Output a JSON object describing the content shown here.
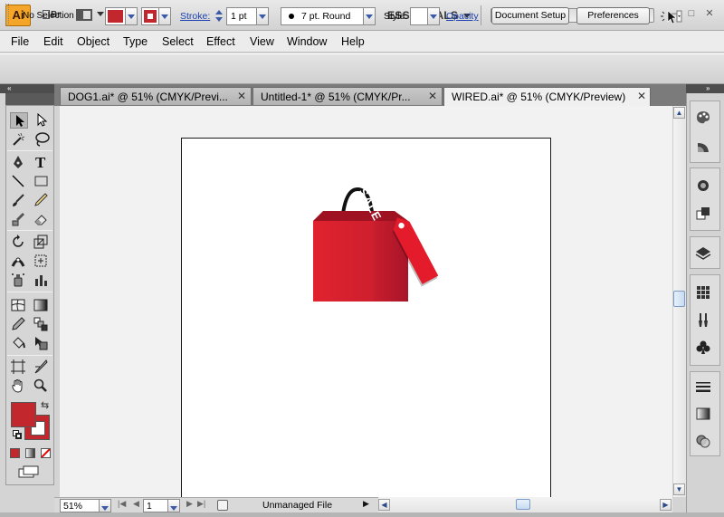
{
  "app": {
    "logo_text": "Ai",
    "bridge_label": "Br",
    "workspace": "ESSENTIALS",
    "window_controls": [
      "–",
      "□",
      "✕"
    ]
  },
  "menu": [
    "File",
    "Edit",
    "Object",
    "Type",
    "Select",
    "Effect",
    "View",
    "Window",
    "Help"
  ],
  "control": {
    "selection_status": "No Selection",
    "fill_color": "#c1272d",
    "stroke_color": "#c1272d",
    "stroke_label": "Stroke:",
    "stroke_weight": "1 pt",
    "brush": "7 pt. Round",
    "style_label": "Style:",
    "opacity_label": "Opacity",
    "document_setup_label": "Document Setup",
    "preferences_label": "Preferences"
  },
  "tabs": [
    {
      "label": "DOG1.ai* @ 51% (CMYK/Previ...",
      "active": false
    },
    {
      "label": "Untitled-1* @ 51% (CMYK/Pr...",
      "active": false
    },
    {
      "label": "WIRED.ai* @ 51% (CMYK/Preview)",
      "active": true
    }
  ],
  "artwork": {
    "tag_text": "SALE",
    "bag_color": "#d41f2b",
    "bag_dark": "#b3162a"
  },
  "status": {
    "zoom": "51%",
    "artboard_number": "1",
    "file_status": "Unmanaged File"
  },
  "icons": {
    "tools": [
      "selection-icon",
      "direct-selection-icon",
      "magic-wand-icon",
      "lasso-icon",
      "pen-icon",
      "type-icon",
      "line-segment-icon",
      "rectangle-icon",
      "paintbrush-icon",
      "pencil-icon",
      "blob-brush-icon",
      "eraser-icon",
      "rotate-icon",
      "scale-icon",
      "width-icon",
      "free-transform-icon",
      "symbol-sprayer-icon",
      "column-graph-icon",
      "mesh-icon",
      "gradient-icon",
      "eyedropper-icon",
      "blend-icon",
      "live-paint-bucket-icon",
      "live-paint-selection-icon",
      "artboard-icon",
      "slice-icon",
      "hand-icon",
      "zoom-icon"
    ],
    "dock": [
      "color-panel-icon",
      "color-guide-icon",
      "appearance-icon",
      "graphic-styles-icon",
      "layers-icon",
      "swatches-icon",
      "brushes-icon",
      "symbols-icon",
      "stroke-icon",
      "gradient-panel-icon",
      "transparency-icon"
    ]
  }
}
